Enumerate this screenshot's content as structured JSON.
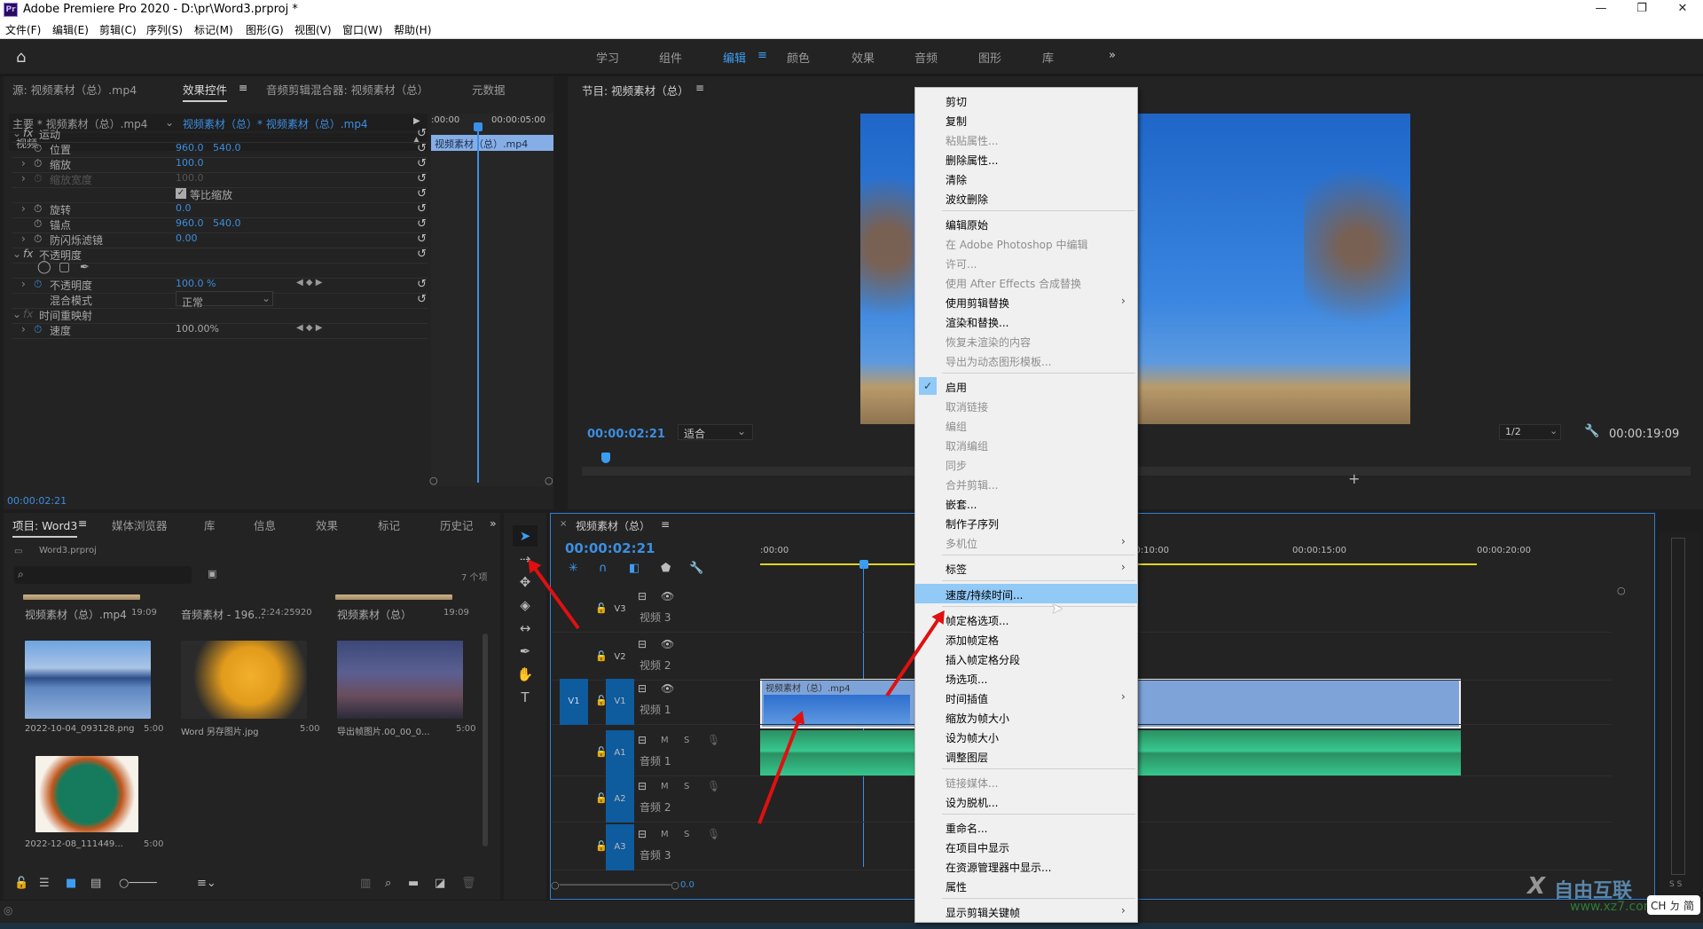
{
  "app": {
    "logo": "Pr",
    "title": "Adobe Premiere Pro 2020 - D:\\pr\\Word3.prproj *",
    "window_controls": [
      "minimize",
      "restore",
      "close"
    ]
  },
  "menubar": [
    "文件(F)",
    "编辑(E)",
    "剪辑(C)",
    "序列(S)",
    "标记(M)",
    "图形(G)",
    "视图(V)",
    "窗口(W)",
    "帮助(H)"
  ],
  "workspaces": {
    "items": [
      "学习",
      "组件",
      "编辑",
      "颜色",
      "效果",
      "音频",
      "图形",
      "库"
    ],
    "active": "编辑",
    "more": "»"
  },
  "effect_controls": {
    "tabs": [
      "源: 视频素材（总）.mp4",
      "效果控件",
      "音频剪辑混合器: 视频素材（总）",
      "元数据"
    ],
    "active_tab": "效果控件",
    "master_label": "主要 * 视频素材（总）.mp4",
    "clip_label": "视频素材（总）* 视频素材（总）.mp4",
    "mini_timecode": ":00:00",
    "mini_timecode2": "00:00:05:00",
    "mini_clip": "视频素材（总）.mp4",
    "section": "视频",
    "rows": [
      {
        "type": "fx",
        "label": "运动"
      },
      {
        "type": "prop",
        "label": "位置",
        "v1": "960.0",
        "v2": "540.0"
      },
      {
        "type": "prop",
        "label": "缩放",
        "v1": "100.0",
        "expand": true
      },
      {
        "type": "prop",
        "label": "缩放宽度",
        "v1": "100.0",
        "expand": true,
        "disabled": true
      },
      {
        "type": "check",
        "label": "等比缩放",
        "checked": true
      },
      {
        "type": "prop",
        "label": "旋转",
        "v1": "0.0",
        "expand": true
      },
      {
        "type": "prop",
        "label": "锚点",
        "v1": "960.0",
        "v2": "540.0"
      },
      {
        "type": "prop",
        "label": "防闪烁滤镜",
        "v1": "0.00",
        "expand": true
      },
      {
        "type": "fx",
        "label": "不透明度"
      },
      {
        "type": "masks"
      },
      {
        "type": "prop",
        "label": "不透明度",
        "v1": "100.0 %",
        "expand": true,
        "keyframe": true
      },
      {
        "type": "select",
        "label": "混合模式",
        "value": "正常"
      },
      {
        "type": "fx",
        "label": "时间重映射",
        "fx_disabled": true
      },
      {
        "type": "prop",
        "label": "速度",
        "v1": "100.00%",
        "expand": true,
        "keyframe": true,
        "plain": true
      }
    ],
    "timecode": "00:00:02:21"
  },
  "program_monitor": {
    "title": "节目: 视频素材（总）",
    "timecode": "00:00:02:21",
    "fit": "适合",
    "resolution": "1/2",
    "duration": "00:00:19:09"
  },
  "project_panel": {
    "tabs": [
      "项目: Word3",
      "媒体浏览器",
      "库",
      "信息",
      "效果",
      "标记",
      "历史记"
    ],
    "active_tab": "项目: Word3",
    "project_file": "Word3.prproj",
    "search_placeholder": "",
    "item_count": "7 个项",
    "items": [
      {
        "name": "视频素材（总）.mp4",
        "duration": "19:09",
        "kind": "video"
      },
      {
        "name": "音频素材 - 196...",
        "duration": "2:24:25920",
        "kind": "audio"
      },
      {
        "name": "视频素材（总）",
        "duration": "19:09",
        "kind": "sequence"
      },
      {
        "name": "2022-10-04_093128.png",
        "duration": "5:00",
        "kind": "mountain"
      },
      {
        "name": "Word 另存图片.jpg",
        "duration": "5:00",
        "kind": "leaf"
      },
      {
        "name": "导出帧图片.00_00_0...",
        "duration": "5:00",
        "kind": "city"
      },
      {
        "name": "2022-12-08_111449...",
        "duration": "5:00",
        "kind": "board"
      }
    ]
  },
  "tools": [
    "selection-tool",
    "track-select-tool",
    "ripple-edit-tool",
    "razor-tool",
    "slip-tool",
    "pen-tool",
    "hand-tool",
    "type-tool"
  ],
  "timeline": {
    "title": "视频素材（总）",
    "timecode": "00:00:02:21",
    "ruler": [
      ":00:00",
      "00:00:10:00",
      "00:00:15:00",
      "00:00:20:00"
    ],
    "tracks": [
      {
        "id": "V3",
        "name": "视频 3",
        "kind": "video"
      },
      {
        "id": "V2",
        "name": "视频 2",
        "kind": "video"
      },
      {
        "id": "V1",
        "name": "视频 1",
        "kind": "video",
        "source": "V1"
      },
      {
        "id": "A1",
        "name": "音频 1",
        "kind": "audio"
      },
      {
        "id": "A2",
        "name": "音频 2",
        "kind": "audio"
      },
      {
        "id": "A3",
        "name": "音频 3",
        "kind": "audio"
      }
    ],
    "video_clip": "视频素材（总）.mp4",
    "mix_value": "0.0",
    "m_label": "M",
    "s_label": "S"
  },
  "context_menu": {
    "items": [
      {
        "label": "剪切"
      },
      {
        "label": "复制"
      },
      {
        "label": "粘贴属性...",
        "disabled": true
      },
      {
        "label": "删除属性..."
      },
      {
        "label": "清除"
      },
      {
        "label": "波纹删除"
      },
      {
        "sep": true
      },
      {
        "label": "编辑原始"
      },
      {
        "label": "在 Adobe Photoshop 中编辑",
        "disabled": true
      },
      {
        "label": "许可...",
        "disabled": true
      },
      {
        "label": "使用 After Effects 合成替换",
        "disabled": true
      },
      {
        "label": "使用剪辑替换",
        "submenu": true
      },
      {
        "label": "渲染和替换..."
      },
      {
        "label": "恢复未渲染的内容",
        "disabled": true
      },
      {
        "label": "导出为动态图形模板...",
        "disabled": true
      },
      {
        "sep": true
      },
      {
        "label": "启用",
        "checked": true
      },
      {
        "label": "取消链接",
        "disabled": true
      },
      {
        "label": "编组",
        "disabled": true
      },
      {
        "label": "取消编组",
        "disabled": true
      },
      {
        "label": "同步",
        "disabled": true
      },
      {
        "label": "合并剪辑...",
        "disabled": true
      },
      {
        "label": "嵌套..."
      },
      {
        "label": "制作子序列"
      },
      {
        "label": "多机位",
        "disabled": true,
        "submenu": true
      },
      {
        "sep": true
      },
      {
        "label": "标签",
        "submenu": true
      },
      {
        "sep": true
      },
      {
        "label": "速度/持续时间...",
        "highlighted": true
      },
      {
        "sep": true
      },
      {
        "label": "帧定格选项..."
      },
      {
        "label": "添加帧定格"
      },
      {
        "label": "插入帧定格分段"
      },
      {
        "label": "场选项..."
      },
      {
        "label": "时间插值",
        "submenu": true
      },
      {
        "label": "缩放为帧大小"
      },
      {
        "label": "设为帧大小"
      },
      {
        "label": "调整图层"
      },
      {
        "sep": true
      },
      {
        "label": "链接媒体...",
        "disabled": true
      },
      {
        "label": "设为脱机..."
      },
      {
        "sep": true
      },
      {
        "label": "重命名..."
      },
      {
        "label": "在项目中显示"
      },
      {
        "label": "在资源管理器中显示..."
      },
      {
        "label": "属性"
      },
      {
        "sep": true
      },
      {
        "label": "显示剪辑关键帧",
        "submenu": true
      }
    ]
  },
  "watermark": {
    "brand": "自由互联",
    "url": "www.xz7.com"
  },
  "ime": "CH ㄉ 简",
  "colors": {
    "accent": "#3d9df2",
    "audio_clip": "#2fc48e",
    "video_clip": "#7ea3d8",
    "highlight": "#91c9f7"
  }
}
